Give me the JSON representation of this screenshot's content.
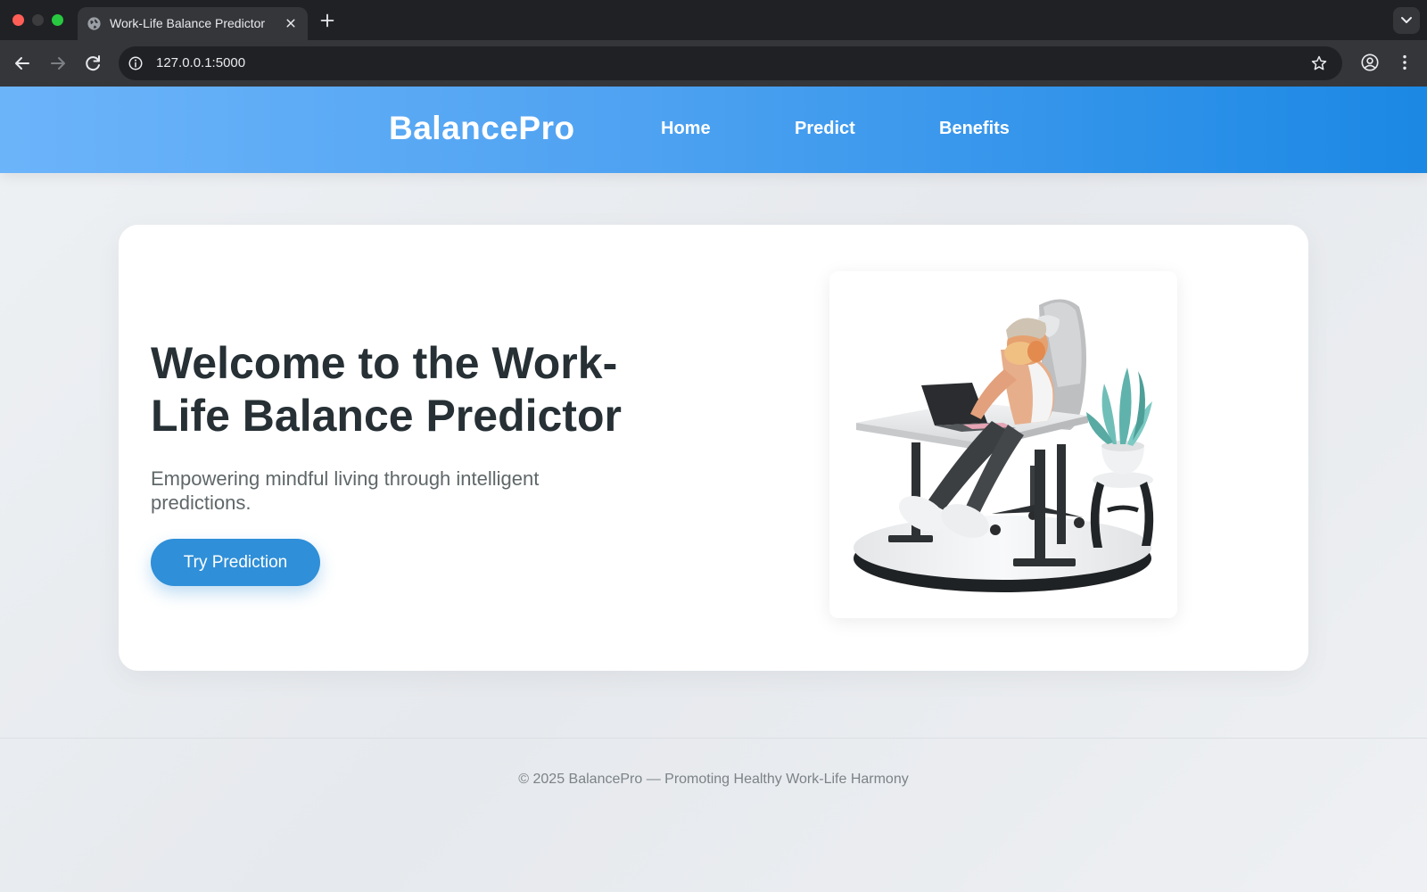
{
  "browser": {
    "tab_title": "Work-Life Balance Predictor",
    "url": "127.0.0.1:5000"
  },
  "header": {
    "brand": "BalancePro",
    "nav": [
      {
        "label": "Home"
      },
      {
        "label": "Predict"
      },
      {
        "label": "Benefits"
      }
    ]
  },
  "hero": {
    "title": "Welcome to the Work-Life Balance Predictor",
    "subtitle": "Empowering mindful living through intelligent predictions.",
    "cta_label": "Try Prediction"
  },
  "footer": {
    "text": "© 2025 BalancePro — Promoting Healthy Work-Life Harmony"
  },
  "colors": {
    "header_gradient_start": "#6cb4fa",
    "header_gradient_end": "#1b88e4",
    "cta": "#2f8fd8",
    "heading": "#263035"
  },
  "icons": [
    "globe-icon",
    "close-icon",
    "plus-icon",
    "chevron-down-icon",
    "back-arrow-icon",
    "forward-arrow-icon",
    "reload-icon",
    "info-icon",
    "star-icon",
    "profile-icon",
    "more-vert-icon"
  ]
}
